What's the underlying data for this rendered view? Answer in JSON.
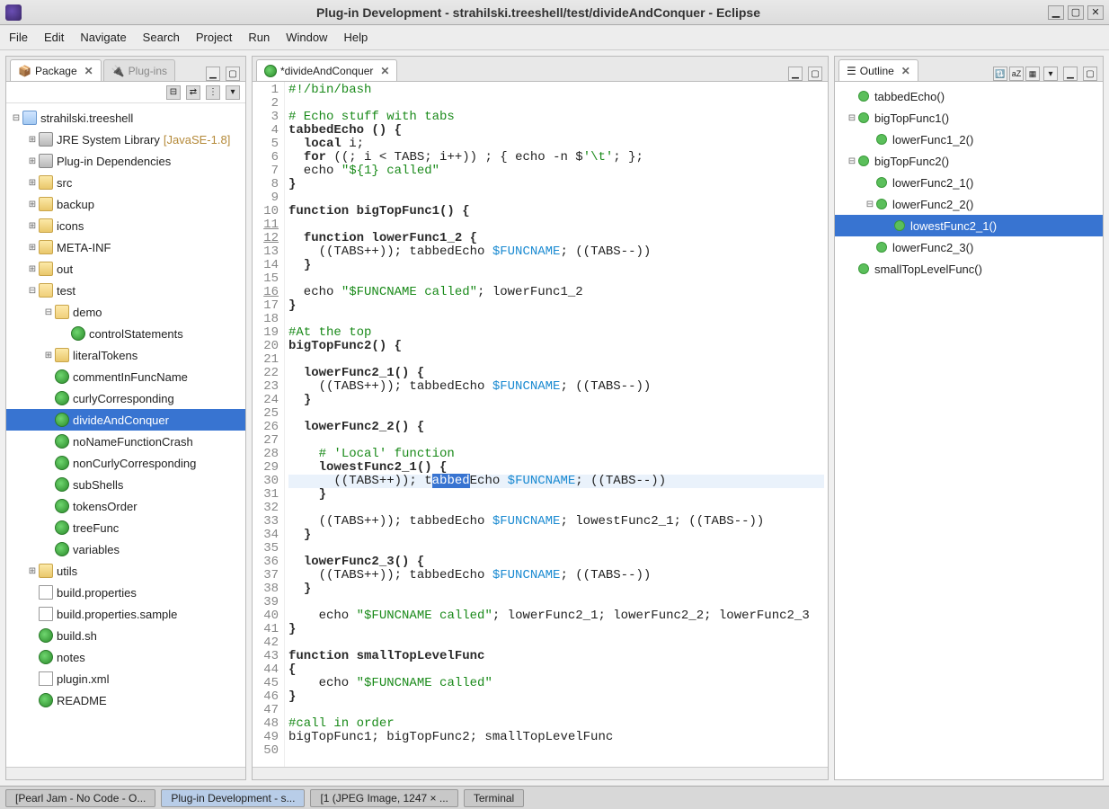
{
  "window": {
    "title": "Plug-in Development - strahilski.treeshell/test/divideAndConquer - Eclipse"
  },
  "menubar": [
    "File",
    "Edit",
    "Navigate",
    "Search",
    "Project",
    "Run",
    "Window",
    "Help"
  ],
  "package_view": {
    "tab_label": "Package",
    "plugins_tab": "Plug-ins",
    "project": "strahilski.treeshell",
    "jre": "JRE System Library",
    "jre_ver": "[JavaSE-1.8]",
    "plugin_deps": "Plug-in Dependencies",
    "folders": {
      "src": "src",
      "backup": "backup",
      "icons": "icons",
      "meta": "META-INF",
      "out": "out",
      "test": "test",
      "demo": "demo",
      "utils": "utils"
    },
    "demo_items": [
      "controlStatements"
    ],
    "test_items": {
      "literalTokens": "literalTokens",
      "commentInFuncName": "commentInFuncName",
      "curlyCorresponding": "curlyCorresponding",
      "divideAndConquer": "divideAndConquer",
      "noNameFunctionCrash": "noNameFunctionCrash",
      "nonCurlyCorresponding": "nonCurlyCorresponding",
      "subShells": "subShells",
      "tokensOrder": "tokensOrder",
      "treeFunc": "treeFunc",
      "variables": "variables"
    },
    "root_files": {
      "build_props": "build.properties",
      "build_props_sample": "build.properties.sample",
      "build_sh": "build.sh",
      "notes": "notes",
      "plugin_xml": "plugin.xml",
      "readme": "README"
    }
  },
  "editor": {
    "tab_label": "*divideAndConquer",
    "lines": [
      {
        "n": 1,
        "h": "<span class='cmt'>#!/bin/bash</span>"
      },
      {
        "n": 2,
        "h": ""
      },
      {
        "n": 3,
        "h": "<span class='cmt'># Echo stuff with tabs</span>"
      },
      {
        "n": 4,
        "h": "<span class='kw'>tabbedEcho () {</span>"
      },
      {
        "n": 5,
        "h": "  <span class='kw'>local</span> i;"
      },
      {
        "n": 6,
        "h": "  <span class='kw'>for</span> ((; i &lt; TABS; i++)) ; { echo -n $<span class='str'>'\\t'</span>; };"
      },
      {
        "n": 7,
        "h": "  echo <span class='str'>\"${1} called\"</span>"
      },
      {
        "n": 8,
        "h": "<span class='kw'>}</span>"
      },
      {
        "n": 9,
        "h": ""
      },
      {
        "n": 10,
        "h": "<span class='kw'>function bigTopFunc1() {</span>"
      },
      {
        "n": 11,
        "h": "",
        "mark": true
      },
      {
        "n": 12,
        "h": "  <span class='kw'>function lowerFunc1_2 {</span>",
        "mark": true
      },
      {
        "n": 13,
        "h": "    ((TABS++)); tabbedEcho <span class='var'>$FUNCNAME</span>; ((TABS--))"
      },
      {
        "n": 14,
        "h": "  <span class='kw'>}</span>"
      },
      {
        "n": 15,
        "h": ""
      },
      {
        "n": 16,
        "h": "  echo <span class='str'>\"$FUNCNAME called\"</span>; lowerFunc1_2",
        "mark": true
      },
      {
        "n": 17,
        "h": "<span class='kw'>}</span>"
      },
      {
        "n": 18,
        "h": ""
      },
      {
        "n": 19,
        "h": "<span class='cmt'>#At the top</span>"
      },
      {
        "n": 20,
        "h": "<span class='kw'>bigTopFunc2() {</span>"
      },
      {
        "n": 21,
        "h": ""
      },
      {
        "n": 22,
        "h": "  <span class='kw'>lowerFunc2_1() {</span>"
      },
      {
        "n": 23,
        "h": "    ((TABS++)); tabbedEcho <span class='var'>$FUNCNAME</span>; ((TABS--))"
      },
      {
        "n": 24,
        "h": "  <span class='kw'>}</span>"
      },
      {
        "n": 25,
        "h": ""
      },
      {
        "n": 26,
        "h": "  <span class='kw'>lowerFunc2_2() {</span>"
      },
      {
        "n": 27,
        "h": ""
      },
      {
        "n": 28,
        "h": "    <span class='cmt'># 'Local' function</span>"
      },
      {
        "n": 29,
        "h": "    <span class='kw'>lowestFunc2_1() {</span>"
      },
      {
        "n": 30,
        "h": "<span class='hl-line'>      ((TABS++)); t<span class='sel'>abbed</span>Echo <span class='var'>$FUNCNAME</span>; ((TABS--))</span>"
      },
      {
        "n": 31,
        "h": "    <span class='kw'>}</span>"
      },
      {
        "n": 32,
        "h": ""
      },
      {
        "n": 33,
        "h": "    ((TABS++)); tabbedEcho <span class='var'>$FUNCNAME</span>; lowestFunc2_1; ((TABS--))"
      },
      {
        "n": 34,
        "h": "  <span class='kw'>}</span>"
      },
      {
        "n": 35,
        "h": ""
      },
      {
        "n": 36,
        "h": "  <span class='kw'>lowerFunc2_3() {</span>"
      },
      {
        "n": 37,
        "h": "    ((TABS++)); tabbedEcho <span class='var'>$FUNCNAME</span>; ((TABS--))"
      },
      {
        "n": 38,
        "h": "  <span class='kw'>}</span>"
      },
      {
        "n": 39,
        "h": ""
      },
      {
        "n": 40,
        "h": "    echo <span class='str'>\"$FUNCNAME called\"</span>; lowerFunc2_1; lowerFunc2_2; lowerFunc2_3"
      },
      {
        "n": 41,
        "h": "<span class='kw'>}</span>"
      },
      {
        "n": 42,
        "h": ""
      },
      {
        "n": 43,
        "h": "<span class='kw'>function smallTopLevelFunc</span>"
      },
      {
        "n": 44,
        "h": "<span class='kw'>{</span>"
      },
      {
        "n": 45,
        "h": "    echo <span class='str'>\"$FUNCNAME called\"</span>"
      },
      {
        "n": 46,
        "h": "<span class='kw'>}</span>"
      },
      {
        "n": 47,
        "h": ""
      },
      {
        "n": 48,
        "h": "<span class='cmt'>#call in order</span>"
      },
      {
        "n": 49,
        "h": "bigTopFunc1; bigTopFunc2; smallTopLevelFunc"
      },
      {
        "n": 50,
        "h": ""
      }
    ]
  },
  "outline": {
    "tab_label": "Outline",
    "items": [
      {
        "label": "tabbedEcho()",
        "depth": 0,
        "twisty": ""
      },
      {
        "label": "bigTopFunc1()",
        "depth": 0,
        "twisty": "⊟"
      },
      {
        "label": "lowerFunc1_2()",
        "depth": 1,
        "twisty": ""
      },
      {
        "label": "bigTopFunc2()",
        "depth": 0,
        "twisty": "⊟"
      },
      {
        "label": "lowerFunc2_1()",
        "depth": 1,
        "twisty": ""
      },
      {
        "label": "lowerFunc2_2()",
        "depth": 1,
        "twisty": "⊟"
      },
      {
        "label": "lowestFunc2_1()",
        "depth": 2,
        "twisty": "",
        "selected": true
      },
      {
        "label": "lowerFunc2_3()",
        "depth": 1,
        "twisty": ""
      },
      {
        "label": "smallTopLevelFunc()",
        "depth": 0,
        "twisty": ""
      }
    ]
  },
  "taskbar": {
    "items": [
      "[Pearl Jam - No Code - O...",
      "Plug-in Development - s...",
      "[1 (JPEG Image, 1247 × ...",
      "Terminal"
    ],
    "active": 1
  }
}
